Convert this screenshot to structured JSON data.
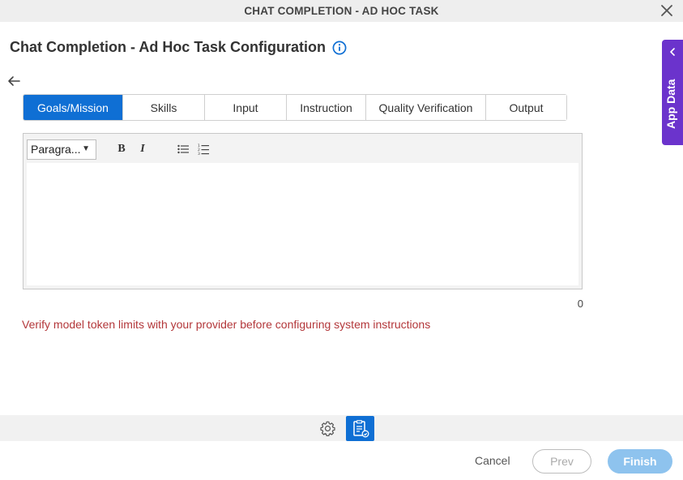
{
  "window": {
    "title": "CHAT COMPLETION - AD HOC TASK"
  },
  "page": {
    "title": "Chat Completion - Ad Hoc Task Configuration"
  },
  "tabs": [
    {
      "label": "Goals/Mission",
      "active": true
    },
    {
      "label": "Skills",
      "active": false
    },
    {
      "label": "Input",
      "active": false
    },
    {
      "label": "Instruction",
      "active": false
    },
    {
      "label": "Quality Verification",
      "active": false
    },
    {
      "label": "Output",
      "active": false
    }
  ],
  "editor": {
    "paragraph_select": "Paragra...",
    "bold_label": "B",
    "italic_label": "I",
    "char_count": "0"
  },
  "warning": "Verify model token limits with your provider before configuring system instructions",
  "side_panel": {
    "label": "App Data"
  },
  "footer": {
    "cancel_label": "Cancel",
    "prev_label": "Prev",
    "finish_label": "Finish"
  },
  "colors": {
    "accent": "#0f6fd4",
    "side_panel": "#6b33cc",
    "warning": "#b3373a",
    "finish_disabled": "#8ec3ee"
  },
  "icons": [
    "close-icon",
    "info-icon",
    "back-arrow-icon",
    "chevron-left-icon",
    "bullet-list-icon",
    "numbered-list-icon",
    "gear-icon",
    "document-icon"
  ]
}
